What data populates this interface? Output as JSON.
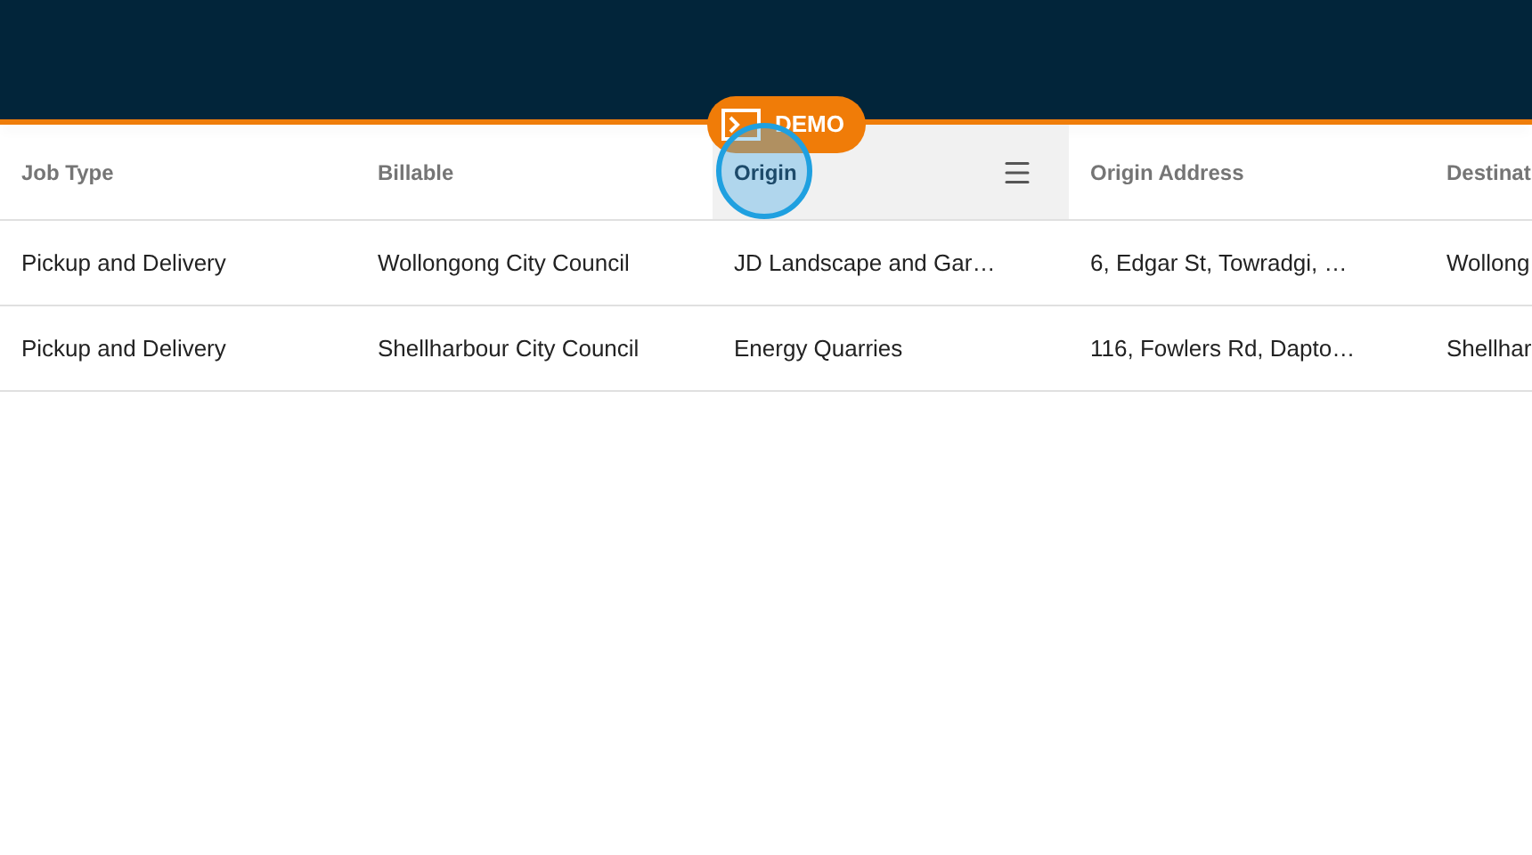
{
  "demo_badge": {
    "label": "DEMO"
  },
  "table": {
    "columns": [
      {
        "label": "Job Type",
        "selected": false
      },
      {
        "label": "Billable",
        "selected": false
      },
      {
        "label": "Origin",
        "selected": true
      },
      {
        "label": "Origin Address",
        "selected": false
      },
      {
        "label": "Destinat",
        "selected": false
      }
    ],
    "rows": [
      [
        "Pickup and Delivery",
        "Wollongong City Council",
        "JD Landscape and Gar…",
        "6, Edgar St, Towradgi, …",
        "Wollong"
      ],
      [
        "Pickup and Delivery",
        "Shellharbour City Council",
        "Energy Quarries",
        "116, Fowlers Rd, Dapto…",
        "Shellhar"
      ]
    ]
  }
}
